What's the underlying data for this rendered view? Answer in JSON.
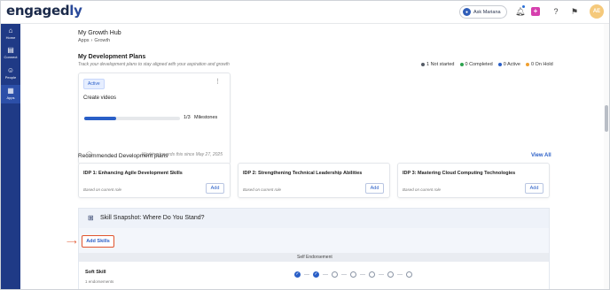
{
  "app": {
    "logo_prefix": "engaged",
    "logo_suffix": "ly"
  },
  "topbar": {
    "ask_label": "Ask Mariana",
    "ask_icon": "assistant-icon",
    "avatar_initials": "AE",
    "icons": [
      "bell-icon",
      "plus-icon",
      "help-icon",
      "flag-icon"
    ],
    "accent": "#2a5fc7",
    "plus_color": "#d63fae"
  },
  "sidebar": {
    "color": "#1f3a86",
    "items": [
      {
        "label": "Home",
        "icon": "home-icon"
      },
      {
        "label": "Connect",
        "icon": "chat-icon"
      },
      {
        "label": "People",
        "icon": "people-icon"
      },
      {
        "label": "Apps",
        "icon": "apps-icon",
        "active": true
      }
    ]
  },
  "page": {
    "title": "My Growth Hub",
    "breadcrumb": [
      "Apps",
      "Growth"
    ]
  },
  "plans": {
    "title": "My Development Plans",
    "subtitle": "Track your development plans to stay aligned with your aspiration and growth",
    "legend": [
      {
        "label": "1 Not started",
        "color": "#555b66"
      },
      {
        "label": "0 Completed",
        "color": "#2ca24e"
      },
      {
        "label": "0 Active",
        "color": "#2a5fc7"
      },
      {
        "label": "0 On Hold",
        "color": "#f0a030"
      }
    ],
    "card": {
      "status": "Active",
      "name": "Create videos",
      "progress": 0.33,
      "milestones_count": "1/3",
      "milestones_label": "Milestones",
      "working_since": "Working towards this since May 27, 2025"
    }
  },
  "recommended": {
    "title": "Recommended Development plans",
    "view_all": "View All",
    "items": [
      {
        "title": "IDP 1: Enhancing Agile Development Skills",
        "basis": "Based on current role",
        "action": "Add"
      },
      {
        "title": "IDP 2: Strengthening Technical Leadership Abilities",
        "basis": "Based on current role",
        "action": "Add"
      },
      {
        "title": "IDP 3: Mastering Cloud Computing Technologies",
        "basis": "Based on current role",
        "action": "Add"
      }
    ]
  },
  "snapshot": {
    "title": "Skill Snapshot: Where Do You Stand?",
    "add_skills": "Add Skills",
    "endorsement_header": "Self Endorsement",
    "skill": {
      "name": "Soft Skill",
      "endorsements": "1 endorsements",
      "rating": 2,
      "scale_max": 7
    }
  }
}
